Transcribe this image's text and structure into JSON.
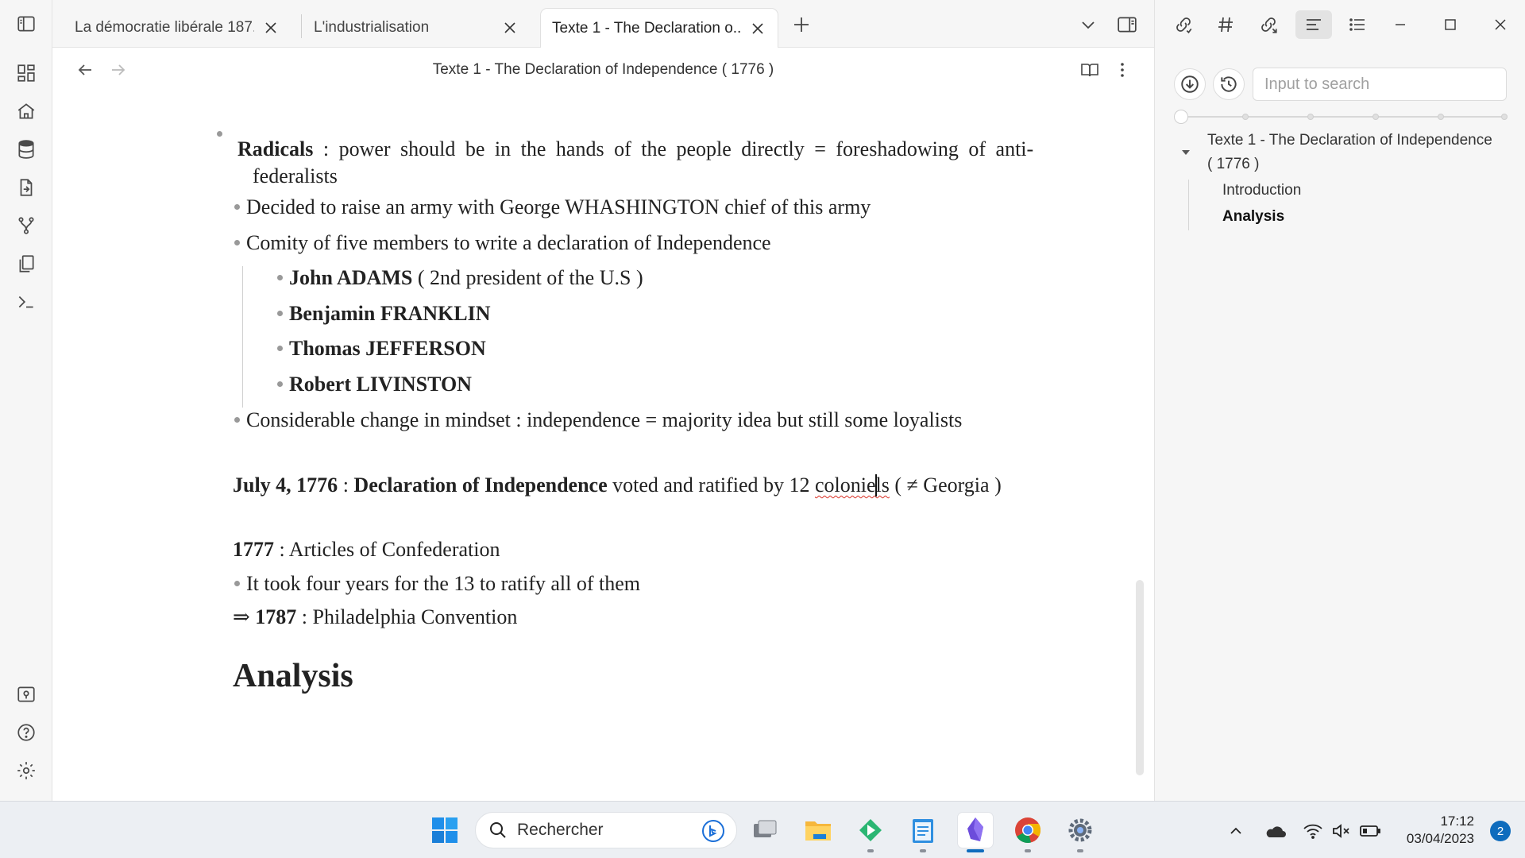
{
  "window": {
    "tabs": [
      {
        "title": "La démocratie libérale 187...",
        "active": false
      },
      {
        "title": "L'industrialisation",
        "active": false
      },
      {
        "title": "Texte 1 - The Declaration o...",
        "active": true
      }
    ],
    "new_tab_icon": "plus-icon",
    "controls": [
      "minimize-icon",
      "maximize-icon",
      "close-icon"
    ]
  },
  "ribbon": {
    "top_icons": [
      "layout-dashboard-icon",
      "home-icon",
      "database-icon",
      "file-export-icon",
      "git-fork-icon",
      "copy-icon",
      "terminal-icon"
    ],
    "bottom_icons": [
      "vault-icon",
      "help-icon",
      "settings-icon"
    ]
  },
  "view_header": {
    "title": "Texte 1 - The Declaration of Independence ( 1776 )"
  },
  "content": {
    "radicals_label": "Radicals",
    "radicals_text": " : power should be in the hands of the people directly = foreshadowing of anti-",
    "radicals_text_cont": "federalists",
    "army_text": "Decided to raise an army with George WHASHINGTON chief of this army",
    "comity_text": "Comity of five members to write a declaration of Independence",
    "members": [
      {
        "name": "John ADAMS",
        "note": " ( 2nd president of the U.S )"
      },
      {
        "name": "Benjamin FRANKLIN",
        "note": ""
      },
      {
        "name": "Thomas JEFFERSON",
        "note": ""
      },
      {
        "name": "Robert LIVINSTON",
        "note": ""
      }
    ],
    "mindset_text": "Considerable change in mindset : independence = majority idea but still some loyalists",
    "july_date": "July 4, 1776",
    "july_sep": " : ",
    "july_title": "Declaration of Independence",
    "july_text": " voted and ratified by 12 ",
    "july_misspelled_a": "colonie",
    "july_misspelled_b": "ls",
    "july_tail": " ( ≠ Georgia )",
    "y1777": "1777",
    "articles_text": " : Articles of Confederation",
    "ratify_text": "It took four years for the 13 to ratify all of them",
    "arrow": "⇒ ",
    "y1787": "1787",
    "convention_text": " : Philadelphia Convention",
    "heading_analysis": "Analysis"
  },
  "right_panel": {
    "search_placeholder": "Input to search",
    "outline": [
      {
        "label": "Texte 1 - The Declaration of Independence",
        "label_cont": "( 1776 )",
        "level": 1
      },
      {
        "label": "Introduction",
        "level": 2
      },
      {
        "label": "Analysis",
        "level": 2,
        "active": true
      }
    ]
  },
  "taskbar": {
    "search_label": "Rechercher",
    "time": "17:12",
    "date": "03/04/2023",
    "notification_count": "2",
    "apps": [
      "windows-start-icon",
      "task-view-icon",
      "file-explorer-icon",
      "app-icon",
      "notepad-icon",
      "obsidian-icon",
      "chrome-icon",
      "settings-app-icon"
    ],
    "tray": [
      "chevron-up-icon",
      "onedrive-icon",
      "wifi-icon",
      "volume-muted-icon",
      "battery-icon"
    ]
  },
  "colors": {
    "accent": "#7b5cf2",
    "taskbar_bg": "#eceff3",
    "panel_bg": "#f6f6f6",
    "badge": "#0f6cbd",
    "spellcheck": "#d93025"
  }
}
